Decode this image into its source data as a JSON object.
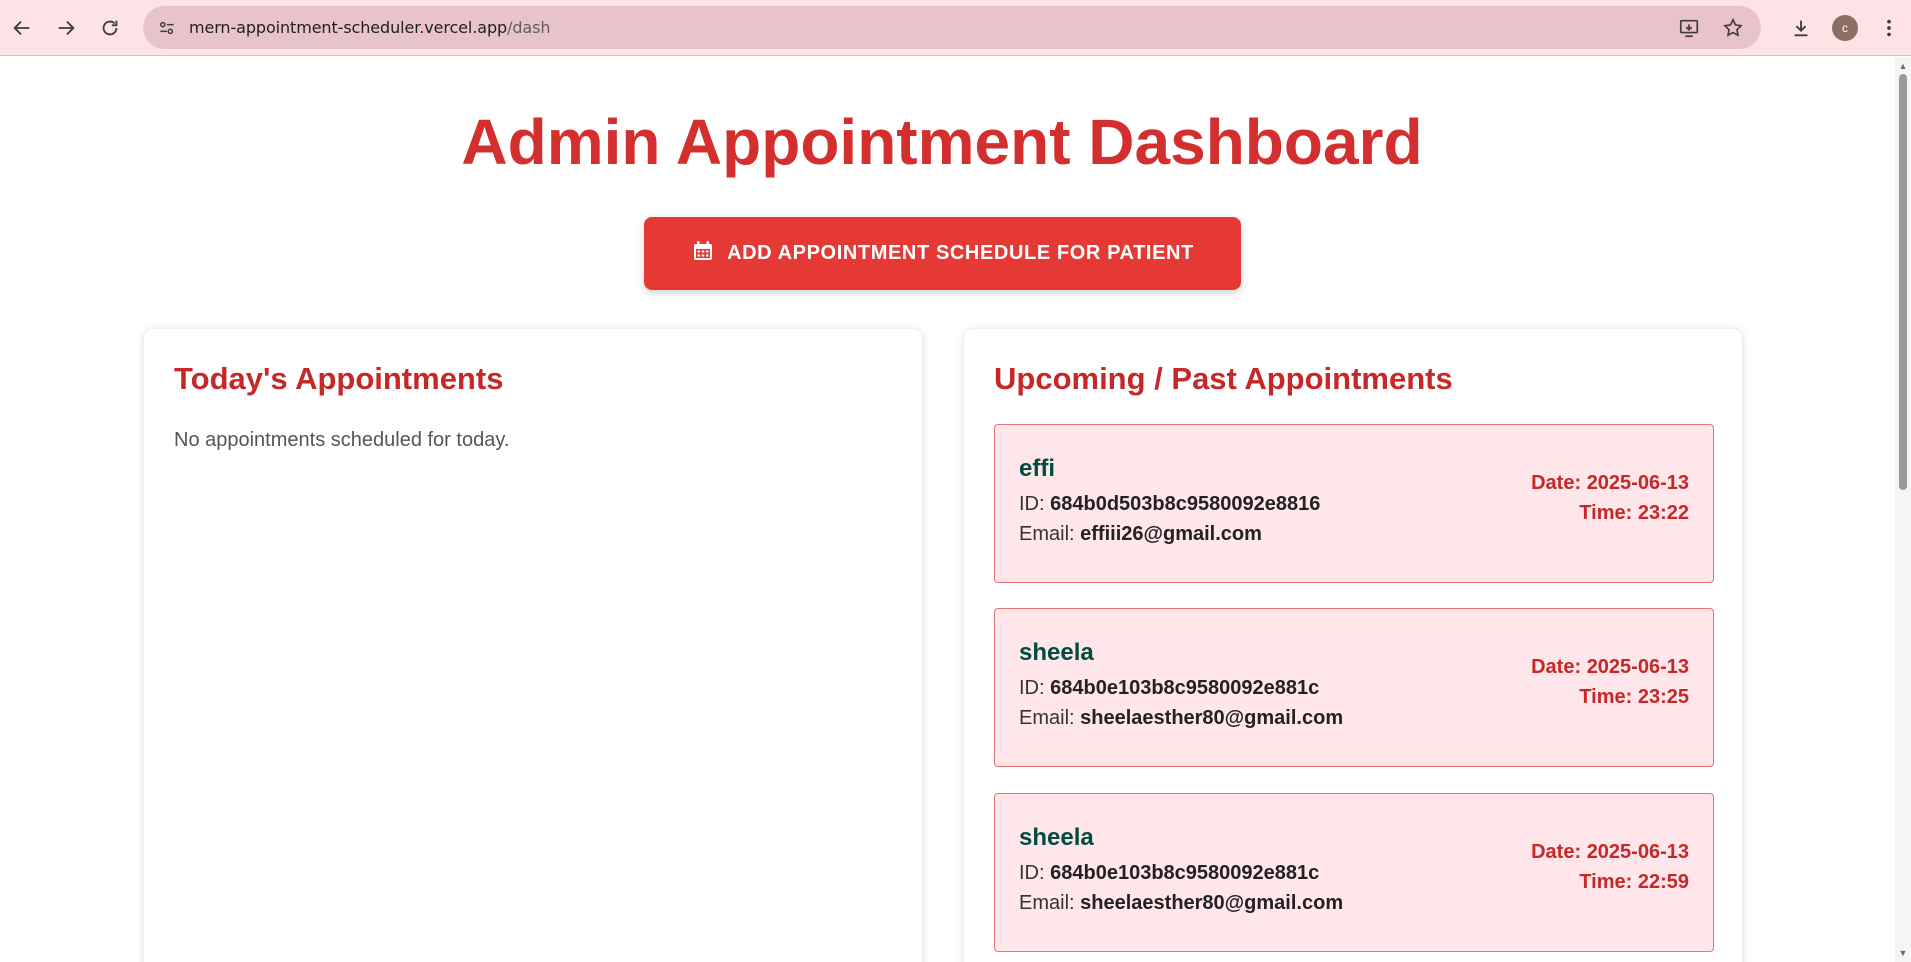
{
  "browser": {
    "url_host": "mern-appointment-scheduler.vercel.app",
    "url_path": "/dash",
    "avatar_letter": "c",
    "icons": [
      "back-arrow-icon",
      "forward-arrow-icon",
      "reload-icon",
      "site-info-icon",
      "install-app-icon",
      "bookmark-star-icon",
      "download-icon",
      "more-vert-icon"
    ]
  },
  "page": {
    "title": "Admin Appointment Dashboard",
    "add_button_label": "ADD APPOINTMENT SCHEDULE FOR PATIENT",
    "add_button_icon": "calendar-icon"
  },
  "today": {
    "heading": "Today's Appointments",
    "empty_message": "No appointments scheduled for today."
  },
  "upcoming": {
    "heading": "Upcoming / Past Appointments",
    "id_label": "ID:",
    "email_label": "Email:",
    "date_label": "Date:",
    "time_label": "Time:",
    "items": [
      {
        "name": "effi",
        "id": "684b0d503b8c9580092e8816",
        "email": "effiii26@gmail.com",
        "date": "2025-06-13",
        "time": "23:22"
      },
      {
        "name": "sheela",
        "id": "684b0e103b8c9580092e881c",
        "email": "sheelaesther80@gmail.com",
        "date": "2025-06-13",
        "time": "23:25"
      },
      {
        "name": "sheela",
        "id": "684b0e103b8c9580092e881c",
        "email": "sheelaesther80@gmail.com",
        "date": "2025-06-13",
        "time": "22:59"
      }
    ]
  },
  "colors": {
    "accent": "#d32f2f",
    "button": "#e53935",
    "card_bg": "#ffe6ea",
    "name_color": "#004d40",
    "chrome_bg": "#fde2e6"
  }
}
